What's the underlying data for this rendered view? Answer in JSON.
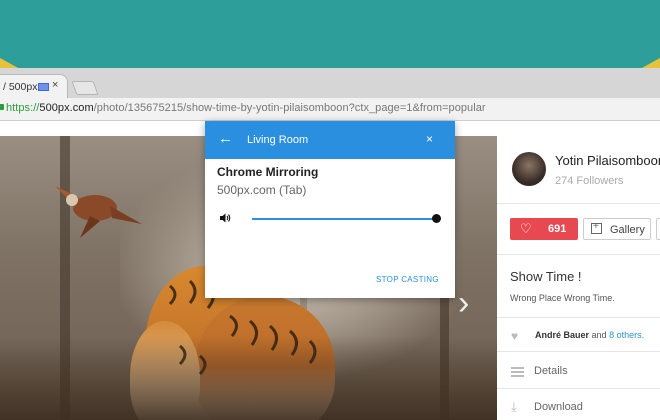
{
  "browser": {
    "tab": {
      "title": "/ 500px",
      "close": "×"
    },
    "address": {
      "scheme": "https://",
      "host": "500px.com",
      "path": "/photo/135675215/show-time-by-yotin-pilaisomboon?ctx_page=1&from=popular"
    }
  },
  "sidebar": {
    "author_name": "Yotin Pilaisomboon",
    "followers": "274 Followers",
    "like_count": "691",
    "gallery_label": "Gallery",
    "title": "Show Time !",
    "description": "Wrong Place Wrong Time.",
    "liked_by": {
      "name": "André Bauer",
      "and": "and",
      "others": "8 others."
    },
    "details_label": "Details",
    "download_label": "Download"
  },
  "cast_dialog": {
    "device": "Living Room",
    "activity": "Chrome Mirroring",
    "source": "500px.com (Tab)",
    "volume_percent": 100,
    "stop_label": "STOP CASTING",
    "close": "×",
    "back": "←"
  },
  "photo": {
    "next": "›"
  },
  "colors": {
    "teal_background": "#2e9e9b",
    "cast_blue": "#2a8fdf",
    "like_red": "#e8484f",
    "link_blue": "#2c91d1",
    "secure_green": "#2a9d3a"
  }
}
